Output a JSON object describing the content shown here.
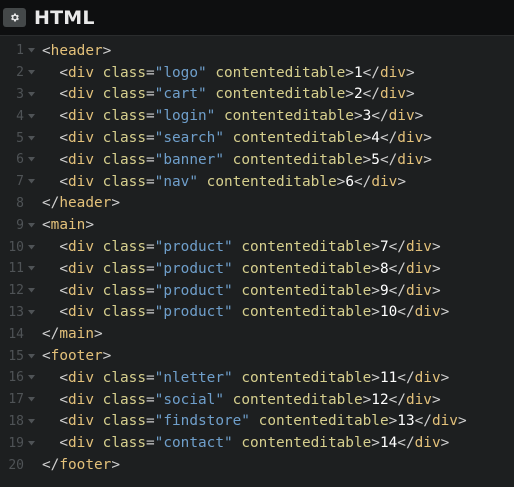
{
  "panel": {
    "title": "HTML",
    "settings_icon": "gear-icon"
  },
  "colors": {
    "background": "#1d1f20",
    "titlebar": "#0e0f10",
    "tag": "#e3c17a",
    "attribute": "#d6cf8e",
    "string": "#6f9fcb",
    "text": "#ffffff",
    "gutter": "#4f5356"
  },
  "lines": [
    {
      "n": "1",
      "fold": true,
      "indent": 0,
      "kind": "open",
      "tag": "header"
    },
    {
      "n": "2",
      "fold": true,
      "indent": 1,
      "kind": "div",
      "cls": "logo",
      "text": "1"
    },
    {
      "n": "3",
      "fold": true,
      "indent": 1,
      "kind": "div",
      "cls": "cart",
      "text": "2"
    },
    {
      "n": "4",
      "fold": true,
      "indent": 1,
      "kind": "div",
      "cls": "login",
      "text": "3"
    },
    {
      "n": "5",
      "fold": true,
      "indent": 1,
      "kind": "div",
      "cls": "search",
      "text": "4"
    },
    {
      "n": "6",
      "fold": true,
      "indent": 1,
      "kind": "div",
      "cls": "banner",
      "text": "5"
    },
    {
      "n": "7",
      "fold": true,
      "indent": 1,
      "kind": "div",
      "cls": "nav",
      "text": "6"
    },
    {
      "n": "8",
      "fold": false,
      "indent": 0,
      "kind": "close",
      "tag": "header"
    },
    {
      "n": "9",
      "fold": true,
      "indent": 0,
      "kind": "open",
      "tag": "main"
    },
    {
      "n": "10",
      "fold": true,
      "indent": 1,
      "kind": "div",
      "cls": "product",
      "text": "7"
    },
    {
      "n": "11",
      "fold": true,
      "indent": 1,
      "kind": "div",
      "cls": "product",
      "text": "8"
    },
    {
      "n": "12",
      "fold": true,
      "indent": 1,
      "kind": "div",
      "cls": "product",
      "text": "9"
    },
    {
      "n": "13",
      "fold": true,
      "indent": 1,
      "kind": "div",
      "cls": "product",
      "text": "10"
    },
    {
      "n": "14",
      "fold": false,
      "indent": 0,
      "kind": "close",
      "tag": "main"
    },
    {
      "n": "15",
      "fold": true,
      "indent": 0,
      "kind": "open",
      "tag": "footer"
    },
    {
      "n": "16",
      "fold": true,
      "indent": 1,
      "kind": "div",
      "cls": "nletter",
      "text": "11"
    },
    {
      "n": "17",
      "fold": true,
      "indent": 1,
      "kind": "div",
      "cls": "social",
      "text": "12"
    },
    {
      "n": "18",
      "fold": true,
      "indent": 1,
      "kind": "div",
      "cls": "findstore",
      "text": "13"
    },
    {
      "n": "19",
      "fold": true,
      "indent": 1,
      "kind": "div",
      "cls": "contact",
      "text": "14"
    },
    {
      "n": "20",
      "fold": false,
      "indent": 0,
      "kind": "close",
      "tag": "footer"
    }
  ],
  "tokens": {
    "div_tag": "div",
    "class_attr": "class",
    "editable_attr": "contenteditable"
  }
}
